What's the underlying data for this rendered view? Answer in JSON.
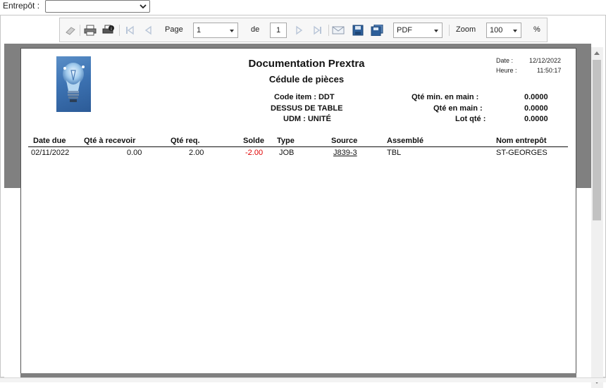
{
  "filter": {
    "label": "Entrepôt :",
    "value": ""
  },
  "toolbar": {
    "page_label": "Page",
    "page_value": "1",
    "of_label": "de",
    "total_pages": "1",
    "export_format": "PDF",
    "zoom_label": "Zoom",
    "zoom_value": "100",
    "percent": "%"
  },
  "report": {
    "title": "Documentation Prextra",
    "subtitle": "Cédule de pièces",
    "date_label": "Date :",
    "date_value": "12/12/2022",
    "time_label": "Heure :",
    "time_value": "11:50:17",
    "item_code": "Code item : DDT",
    "item_desc": "DESSUS DE TABLE",
    "uom": "UDM : UNITÉ",
    "qty_min_label": "Qté min. en main :",
    "qty_min_value": "0.0000",
    "qty_on_hand_label": "Qté en main :",
    "qty_on_hand_value": "0.0000",
    "lot_qty_label": "Lot qté :",
    "lot_qty_value": "0.0000",
    "columns": [
      "Date due",
      "Qté à recevoir",
      "Qté req.",
      "Solde",
      "Type",
      "Source",
      "Assemblé",
      "Nom entrepôt"
    ],
    "rows": [
      [
        "02/11/2022",
        "0.00",
        "2.00",
        "-2.00",
        "JOB",
        "J839-3",
        "TBL",
        "ST-GEORGES"
      ]
    ]
  },
  "colors": {
    "negative": "#e00000",
    "canvas": "#808080"
  },
  "icons": [
    "eraser-icon",
    "print-icon",
    "print-options-icon",
    "first-page-icon",
    "previous-page-icon",
    "next-page-icon",
    "last-page-icon",
    "email-icon",
    "save-icon",
    "save-all-icon",
    "dropdown-arrow-icon"
  ]
}
